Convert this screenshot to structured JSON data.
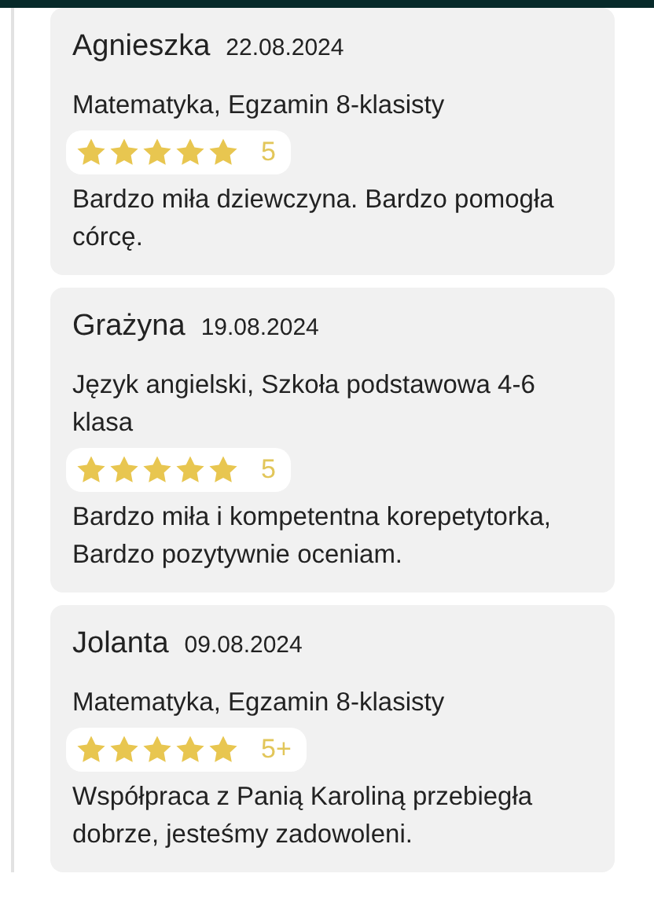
{
  "reviews": [
    {
      "name": "Agnieszka",
      "date": "22.08.2024",
      "subject": "Matematyka, Egzamin 8-klasisty",
      "stars": 5,
      "rating": "5",
      "text": "Bardzo miła dziewczyna. Bardzo pomogła córcę."
    },
    {
      "name": "Grażyna",
      "date": "19.08.2024",
      "subject": "Język angielski, Szkoła podstawowa 4-6 klasa",
      "stars": 5,
      "rating": "5",
      "text": "Bardzo miła i kompetentna korepetytorka, Bardzo pozytywnie oceniam."
    },
    {
      "name": "Jolanta",
      "date": "09.08.2024",
      "subject": "Matematyka, Egzamin 8-klasisty",
      "stars": 5,
      "rating": "5+",
      "text": "Współpraca z Panią Karoliną przebiegła dobrze, jesteśmy zadowoleni."
    }
  ]
}
